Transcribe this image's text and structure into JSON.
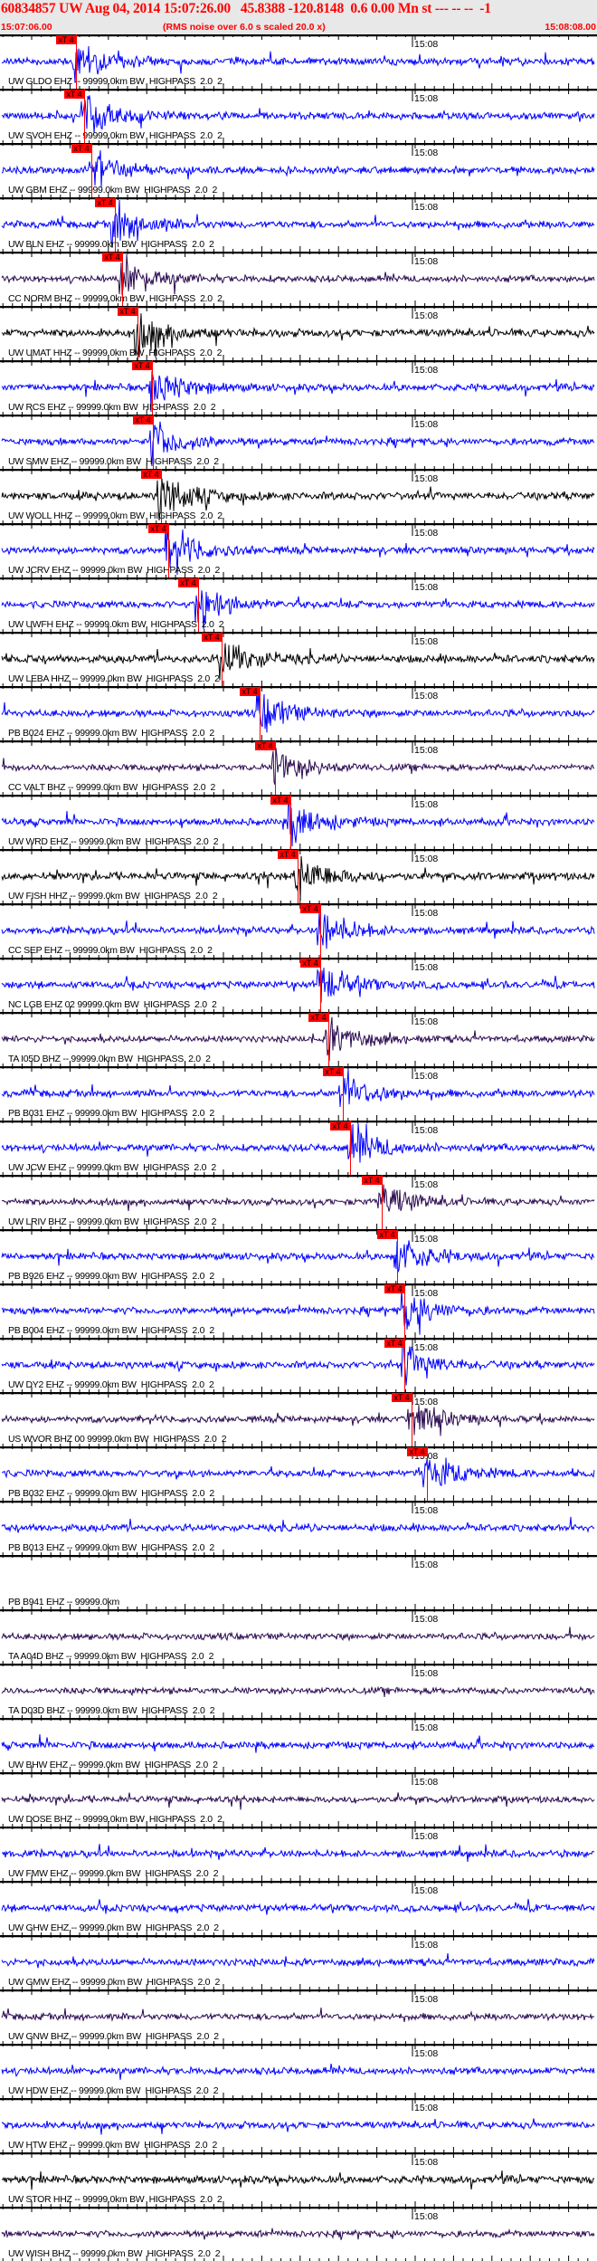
{
  "header": {
    "event_line": "60834857 UW Aug 04, 2014 15:07:26.00   45.8388 -120.8148  0.6 0.00 Mn st --- -- --  -1",
    "start_time": "15:07:06.00",
    "rms_note": "(RMS noise over 6.0 s scaled 20.0 x)",
    "end_time": "15:08:08.00"
  },
  "time_axis": {
    "start": "15:07:06.00",
    "end": "15:08:08.00",
    "span_s": 62,
    "marker_label": "15:08"
  },
  "pick_label": "xT 4",
  "colors": {
    "EHZ": "#0000ff",
    "BHZ": "#2a0a50",
    "HHZ": "#000000",
    "pick": "#ff0000"
  },
  "traces": [
    {
      "label": "UW GLDO EHZ -- 99999.0km BW  HIGHPASS  2.0  2",
      "channel": "EHZ",
      "pick_s": 7.9
    },
    {
      "label": "UW SVOH EHZ -- 99999.0km BW  HIGHPASS  2.0  2",
      "channel": "EHZ",
      "pick_s": 8.7
    },
    {
      "label": "UW GBM EHZ -- 99999.0km BW  HIGHPASS  2.0  2",
      "channel": "EHZ",
      "pick_s": 9.5
    },
    {
      "label": "UW BLN EHZ -- 99999.0km BW  HIGHPASS  2.0  2",
      "channel": "EHZ",
      "pick_s": 11.9
    },
    {
      "label": "CC NORM BHZ -- 99999.0km BW  HIGHPASS  2.0  2",
      "channel": "BHZ",
      "pick_s": 12.7
    },
    {
      "label": "UW UMAT HHZ -- 99999.0km BW  HIGHPASS  2.0  2",
      "channel": "HHZ",
      "pick_s": 14.3
    },
    {
      "label": "UW RCS EHZ -- 99999.0km BW  HIGHPASS  2.0  2",
      "channel": "EHZ",
      "pick_s": 15.8
    },
    {
      "label": "UW SMW EHZ -- 99999.0km BW  HIGHPASS  2.0  2",
      "channel": "EHZ",
      "pick_s": 15.9
    },
    {
      "label": "UW WOLL HHZ -- 99999.0km BW  HIGHPASS  2.0  2",
      "channel": "HHZ",
      "pick_s": 16.7
    },
    {
      "label": "UW JCRV EHZ -- 99999.0km BW  HIGHPASS  2.0  2",
      "channel": "EHZ",
      "pick_s": 17.5
    },
    {
      "label": "UW UWFH EHZ -- 99999.0km BW  HIGHPASS  2.0  2",
      "channel": "EHZ",
      "pick_s": 20.6
    },
    {
      "label": "UW LEBA HHZ -- 99999.0km BW  HIGHPASS  2.0  2",
      "channel": "HHZ",
      "pick_s": 23.0
    },
    {
      "label": "PB B024 EHZ -- 99999.0km BW  HIGHPASS  2.0  2",
      "channel": "EHZ",
      "pick_s": 27.0
    },
    {
      "label": "CC VALT BHZ -- 99999.0km BW  HIGHPASS  2.0  2",
      "channel": "BHZ",
      "pick_s": 28.6
    },
    {
      "label": "UW WRD EHZ -- 99999.0km BW  HIGHPASS  2.0  2",
      "channel": "EHZ",
      "pick_s": 30.2
    },
    {
      "label": "UW FISH HHZ -- 99999.0km BW  HIGHPASS  2.0  2",
      "channel": "HHZ",
      "pick_s": 30.9
    },
    {
      "label": "CC SEP EHZ -- 99999.0km BW  HIGHPASS  2.0  2",
      "channel": "EHZ",
      "pick_s": 33.3
    },
    {
      "label": "NC LGB EHZ 02 99999.0km BW  HIGHPASS  2.0  2",
      "channel": "EHZ",
      "pick_s": 33.3
    },
    {
      "label": "TA I05D BHZ -- 99999.0km BW  HIGHPASS  2.0  2",
      "channel": "BHZ",
      "pick_s": 34.1
    },
    {
      "label": "PB B031 EHZ -- 99999.0km BW  HIGHPASS  2.0  2",
      "channel": "EHZ",
      "pick_s": 35.6
    },
    {
      "label": "UW JCW EHZ -- 99999.0km BW  HIGHPASS  2.0  2",
      "channel": "EHZ",
      "pick_s": 36.4
    },
    {
      "label": "UW LRIV BHZ -- 99999.0km BW  HIGHPASS  2.0  2",
      "channel": "BHZ",
      "pick_s": 39.6
    },
    {
      "label": "PB B926 EHZ -- 99999.0km BW  HIGHPASS  2.0  2",
      "channel": "EHZ",
      "pick_s": 41.2
    },
    {
      "label": "PB B004 EHZ -- 99999.0km BW  HIGHPASS  2.0  2",
      "channel": "EHZ",
      "pick_s": 42.0
    },
    {
      "label": "UW DY2 EHZ -- 99999.0km BW  HIGHPASS  2.0  2",
      "channel": "EHZ",
      "pick_s": 42.0
    },
    {
      "label": "US WVOR BHZ 00 99999.0km BW  HIGHPASS  2.0  2",
      "channel": "BHZ",
      "pick_s": 42.7
    },
    {
      "label": "PB B032 EHZ -- 99999.0km BW  HIGHPASS  2.0  2",
      "channel": "EHZ",
      "pick_s": 44.3
    },
    {
      "label": "PB B013 EHZ -- 99999.0km BW  HIGHPASS  2.0  2",
      "channel": "EHZ"
    },
    {
      "label": "PB B941 EHZ -- 99999.0km",
      "channel": "EHZ",
      "no_data": true
    },
    {
      "label": "TA A04D BHZ -- 99999.0km BW  HIGHPASS  2.0  2",
      "channel": "BHZ"
    },
    {
      "label": "TA D03D BHZ -- 99999.0km BW  HIGHPASS  2.0  2",
      "channel": "BHZ"
    },
    {
      "label": "UW BHW EHZ -- 99999.0km BW  HIGHPASS  2.0  2",
      "channel": "EHZ"
    },
    {
      "label": "UW DOSE BHZ -- 99999.0km BW  HIGHPASS  2.0  2",
      "channel": "BHZ"
    },
    {
      "label": "UW FMW EHZ -- 99999.0km BW  HIGHPASS  2.0  2",
      "channel": "EHZ"
    },
    {
      "label": "UW GHW EHZ -- 99999.0km BW  HIGHPASS  2.0  2",
      "channel": "EHZ"
    },
    {
      "label": "UW GMW EHZ -- 99999.0km BW  HIGHPASS  2.0  2",
      "channel": "EHZ"
    },
    {
      "label": "UW GNW BHZ -- 99999.0km BW  HIGHPASS  2.0  2",
      "channel": "BHZ"
    },
    {
      "label": "UW HDW EHZ -- 99999.0km BW  HIGHPASS  2.0  2",
      "channel": "EHZ"
    },
    {
      "label": "UW HTW EHZ -- 99999.0km BW  HIGHPASS  2.0  2",
      "channel": "EHZ"
    },
    {
      "label": "UW STOR HHZ -- 99999.0km BW  HIGHPASS  2.0  2",
      "channel": "HHZ"
    },
    {
      "label": "UW WISH BHZ -- 99999.0km BW  HIGHPASS  2.0  2",
      "channel": "BHZ"
    }
  ]
}
